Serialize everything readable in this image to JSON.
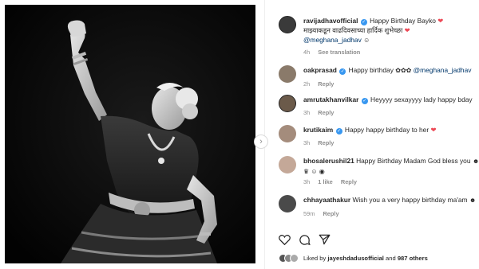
{
  "post": {
    "photo_alt": "Black and white photo of a classical dancer with raised arm"
  },
  "comments": [
    {
      "username": "ravijadhavofficial",
      "verified": true,
      "text": "Happy Birthday Bayko",
      "text2": "माझ्याकडून वाढदिवसाच्या हार्दिक शुभेच्छा",
      "mention": "@meghana_jadhav",
      "time": "4h",
      "action": "See translation"
    },
    {
      "username": "oakprasad",
      "verified": true,
      "text": "Happy birthday",
      "mention": "@meghana_jadhav",
      "time": "2h",
      "action": "Reply"
    },
    {
      "username": "amrutakhanvilkar",
      "verified": true,
      "text": "Heyyyy sexayyyy lady happy bday",
      "time": "3h",
      "action": "Reply"
    },
    {
      "username": "krutikaim",
      "verified": true,
      "text": "Happy happy birthday to her",
      "time": "3h",
      "action": "Reply"
    },
    {
      "username": "bhosalerushil21",
      "verified": false,
      "text": "Happy Birthday Madam God bless you",
      "time": "3h",
      "likes": "1 like",
      "action": "Reply"
    },
    {
      "username": "chhayaathakur",
      "verified": false,
      "text": "Wish you a very happy birthday ma'am",
      "time": "59m",
      "action": "Reply"
    }
  ],
  "liked_by": {
    "prefix": "Liked by",
    "user": "jayeshdadusofficial",
    "joiner": "and",
    "others": "987 others"
  },
  "colors": {
    "verified": "#3897f0",
    "heart": "#ed4956",
    "mention": "#00376b",
    "meta": "#8e8e8e"
  }
}
